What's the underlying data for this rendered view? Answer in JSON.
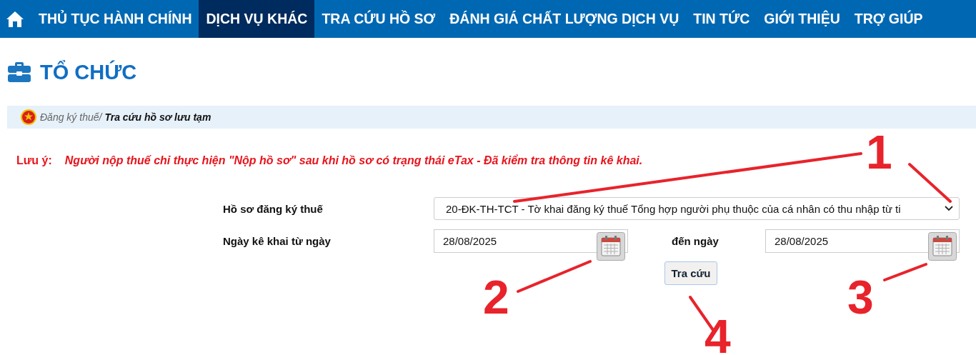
{
  "nav": {
    "items": [
      {
        "label": "THỦ TỤC HÀNH CHÍNH",
        "selected": false
      },
      {
        "label": "DỊCH VỤ KHÁC",
        "selected": true
      },
      {
        "label": "TRA CỨU HỒ SƠ",
        "selected": false
      },
      {
        "label": "ĐÁNH GIÁ CHẤT LƯỢNG DỊCH VỤ",
        "selected": false
      },
      {
        "label": "TIN TỨC",
        "selected": false
      },
      {
        "label": "GIỚI THIỆU",
        "selected": false
      },
      {
        "label": "TRỢ GIÚP",
        "selected": false
      }
    ]
  },
  "page_title": "TỔ CHỨC",
  "breadcrumb": {
    "parent": "Đăng ký thuế/",
    "current": "Tra cứu hồ sơ lưu tạm"
  },
  "notice": {
    "label": "Lưu ý:",
    "text": "Người nộp thuế chỉ thực hiện \"Nộp hồ sơ\" sau khi hồ sơ có trạng thái eTax - Đã kiểm tra thông tin kê khai."
  },
  "form": {
    "dossier": {
      "label": "Hồ sơ đăng ký thuế",
      "value": "20-ĐK-TH-TCT - Tờ khai đăng ký thuế Tổng hợp người phụ thuộc của cá nhân có thu nhập từ ti"
    },
    "from_date": {
      "label": "Ngày kê khai từ ngày",
      "value": "28/08/2025"
    },
    "to_date": {
      "label": "đến ngày",
      "value": "28/08/2025"
    },
    "search_button": "Tra cứu"
  },
  "annotations": [
    "1",
    "2",
    "3",
    "4"
  ]
}
